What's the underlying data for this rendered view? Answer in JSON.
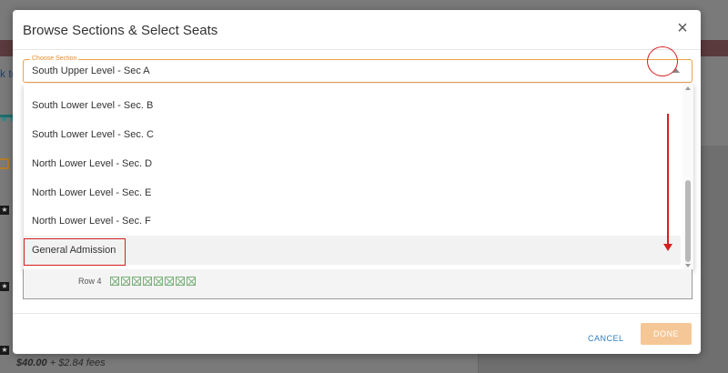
{
  "background": {
    "back_link": "k to",
    "price": "$40.00",
    "fees": " + $2.84 fees"
  },
  "modal": {
    "title": "Browse Sections & Select Seats",
    "close_symbol": "×",
    "select": {
      "legend": "Choose Section",
      "value": "South Upper Level - Sec A"
    },
    "options": [
      "South Lower Level - Sec. B",
      "South Lower Level - Sec. C",
      "North Lower Level - Sec. D",
      "North Lower Level - Sec. E",
      "North Lower Level - Sec. F",
      "General Admission"
    ],
    "highlighted_option": "General Admission",
    "seats": {
      "row_label": "Row 4",
      "seat_count": 8
    },
    "footer": {
      "cancel_label": "CANCEL",
      "done_label": "DONE"
    }
  },
  "colors": {
    "accent_orange": "#f0a04a",
    "annotation_red": "#d42020",
    "done_button": "#f6c796",
    "cancel_link": "#2f7fbf"
  }
}
